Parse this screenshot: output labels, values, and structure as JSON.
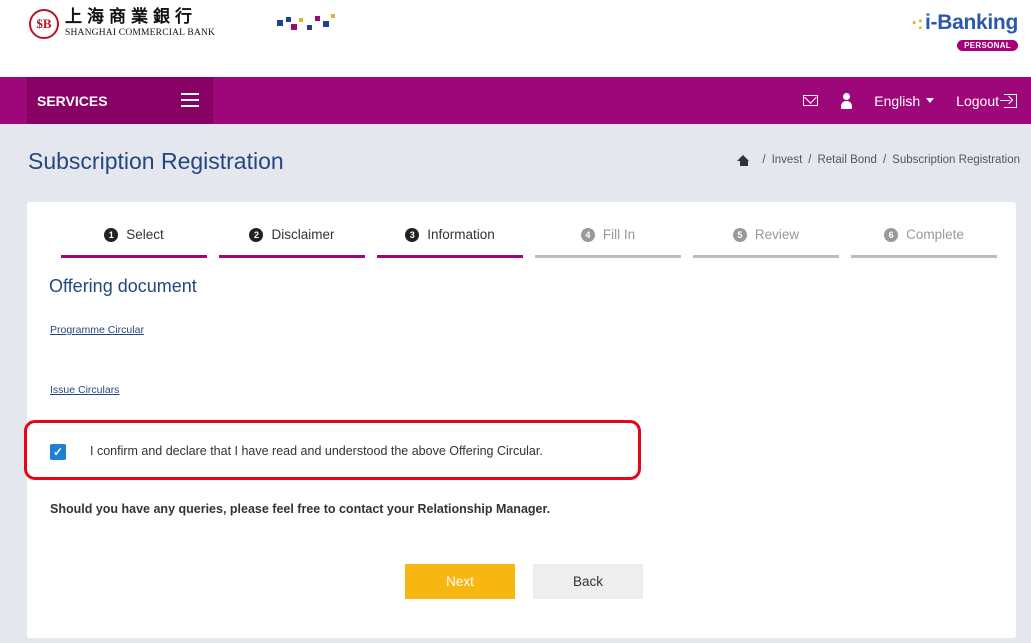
{
  "header": {
    "bank_logo_mark": "$B",
    "bank_name_cn": "上海商業銀行",
    "bank_name_en": "SHANGHAI COMMERCIAL BANK",
    "ibanking_title": "i-Banking",
    "ibanking_badge": "PERSONAL"
  },
  "nav": {
    "services_label": "SERVICES",
    "language_label": "English",
    "logout_label": "Logout",
    "icons": [
      "menu-icon",
      "mail-icon",
      "user-icon",
      "logout-icon"
    ]
  },
  "page": {
    "title": "Subscription Registration",
    "breadcrumb": [
      "Invest",
      "Retail Bond",
      "Subscription Registration"
    ]
  },
  "steps": [
    {
      "num": "1",
      "label": "Select",
      "status": "done"
    },
    {
      "num": "2",
      "label": "Disclaimer",
      "status": "done"
    },
    {
      "num": "3",
      "label": "Information",
      "status": "current"
    },
    {
      "num": "4",
      "label": "Fill In",
      "status": "pending"
    },
    {
      "num": "5",
      "label": "Review",
      "status": "pending"
    },
    {
      "num": "6",
      "label": "Complete",
      "status": "pending"
    }
  ],
  "content": {
    "section_title": "Offering document",
    "links": [
      "Programme Circular",
      "Issue Circulars"
    ],
    "confirm_checked": true,
    "confirm_text": "I confirm and declare that I have read and understood the above Offering Circular.",
    "query_text": "Should you have any queries, please feel free to contact your Relationship Manager."
  },
  "buttons": {
    "next_label": "Next",
    "back_label": "Back"
  },
  "colors": {
    "brand_magenta": "#9e0779",
    "brand_magenta_dark": "#870264",
    "title_blue": "#24477f",
    "next_button": "#f8b613",
    "checkbox_blue": "#1d80d6",
    "highlight_red": "#e5061c"
  }
}
